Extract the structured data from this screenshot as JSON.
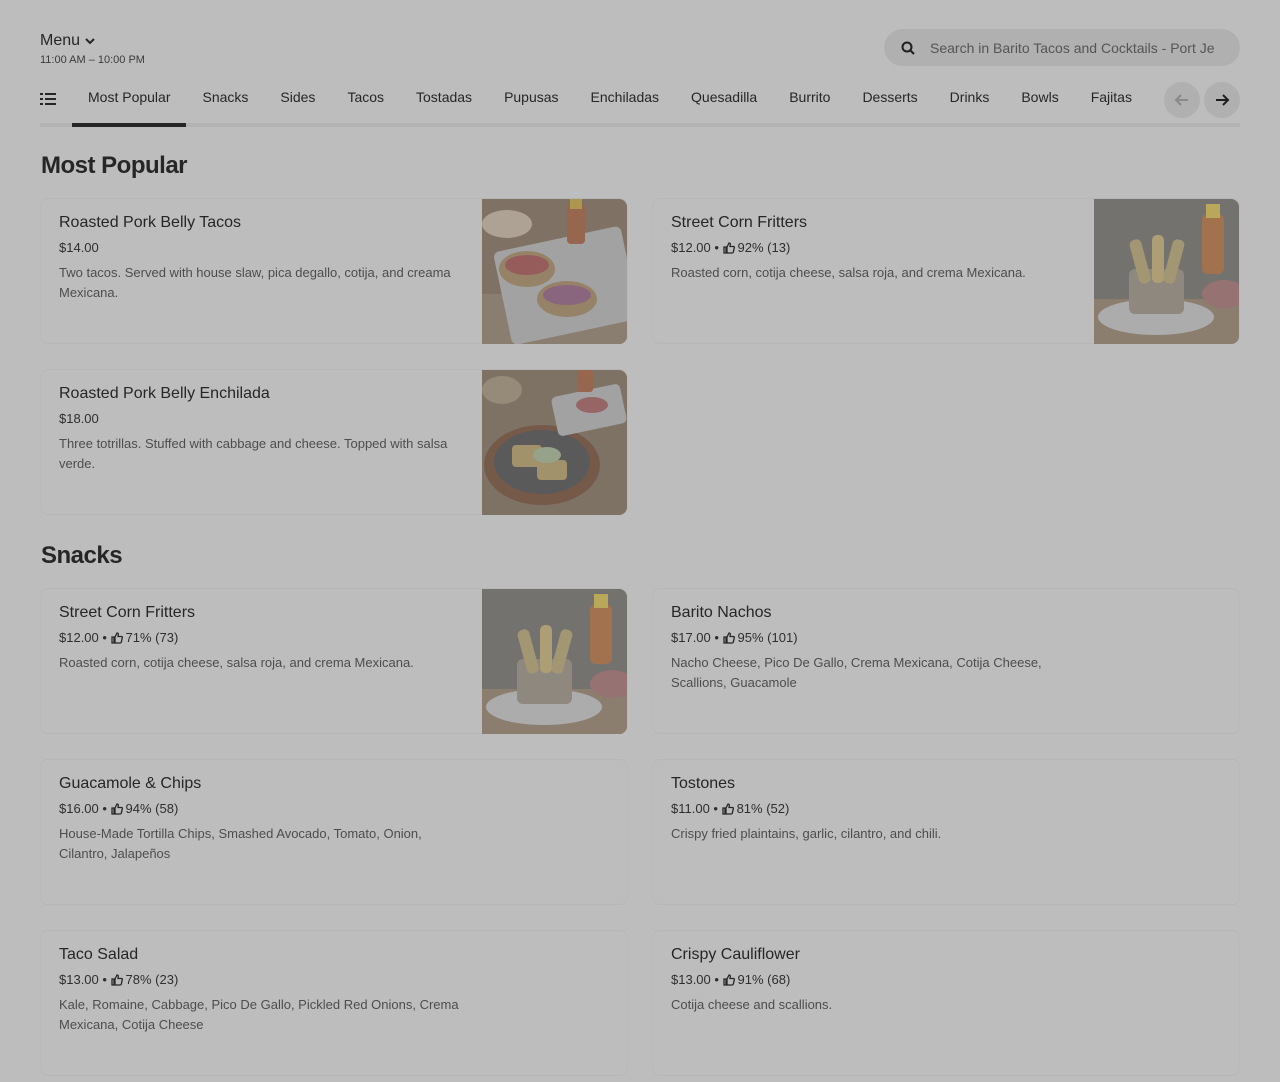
{
  "header": {
    "menu_label": "Menu",
    "hours": "11:00 AM – 10:00 PM"
  },
  "search": {
    "placeholder": "Search in Barito Tacos and Cocktails - Port Je"
  },
  "tabs": [
    {
      "label": "Most Popular",
      "active": true
    },
    {
      "label": "Snacks"
    },
    {
      "label": "Sides"
    },
    {
      "label": "Tacos"
    },
    {
      "label": "Tostadas"
    },
    {
      "label": "Pupusas"
    },
    {
      "label": "Enchiladas"
    },
    {
      "label": "Quesadilla"
    },
    {
      "label": "Burrito"
    },
    {
      "label": "Desserts"
    },
    {
      "label": "Drinks"
    },
    {
      "label": "Bowls"
    },
    {
      "label": "Fajitas"
    }
  ],
  "sections": [
    {
      "title": "Most Popular",
      "items": [
        {
          "name": "Roasted Pork Belly Tacos",
          "price": "$14.00",
          "rating": "",
          "desc": "Two tacos. Served with house slaw, pica degallo, cotija, and creama Mexicana.",
          "image": "tacos-photo"
        },
        {
          "name": "Street Corn Fritters",
          "price": "$12.00",
          "rating": "92% (13)",
          "desc": "Roasted corn, cotija cheese, salsa roja, and crema Mexicana.",
          "image": "corn-fritters-photo"
        },
        {
          "name": "Roasted Pork Belly Enchilada",
          "price": "$18.00",
          "rating": "",
          "desc": "Three totrillas. Stuffed with cabbage and cheese. Topped with salsa verde.",
          "image": "enchilada-photo"
        }
      ]
    },
    {
      "title": "Snacks",
      "items": [
        {
          "name": "Street Corn Fritters",
          "price": "$12.00",
          "rating": "71% (73)",
          "desc": "Roasted corn, cotija cheese, salsa roja, and crema Mexicana.",
          "image": "corn-fritters-photo"
        },
        {
          "name": "Barito Nachos",
          "price": "$17.00",
          "rating": "95% (101)",
          "desc": "Nacho Cheese, Pico De Gallo, Crema Mexicana, Cotija Cheese, Scallions, Guacamole",
          "image": ""
        },
        {
          "name": "Guacamole & Chips",
          "price": "$16.00",
          "rating": "94% (58)",
          "desc": "House-Made Tortilla Chips, Smashed Avocado, Tomato, Onion, Cilantro, Jalapeños",
          "image": ""
        },
        {
          "name": "Tostones",
          "price": "$11.00",
          "rating": "81% (52)",
          "desc": "Crispy fried plaintains, garlic, cilantro, and chili.",
          "image": ""
        },
        {
          "name": "Taco Salad",
          "price": "$13.00",
          "rating": "78% (23)",
          "desc": "Kale, Romaine, Cabbage, Pico De Gallo, Pickled Red Onions, Crema Mexicana, Cotija Cheese",
          "image": ""
        },
        {
          "name": "Crispy Cauliflower",
          "price": "$13.00",
          "rating": "91% (68)",
          "desc": "Cotija cheese and scallions.",
          "image": ""
        }
      ]
    }
  ],
  "colors": {
    "overlay_bg": "#bdbdbd",
    "text_primary": "#262626",
    "text_secondary": "#4d4d4d"
  }
}
